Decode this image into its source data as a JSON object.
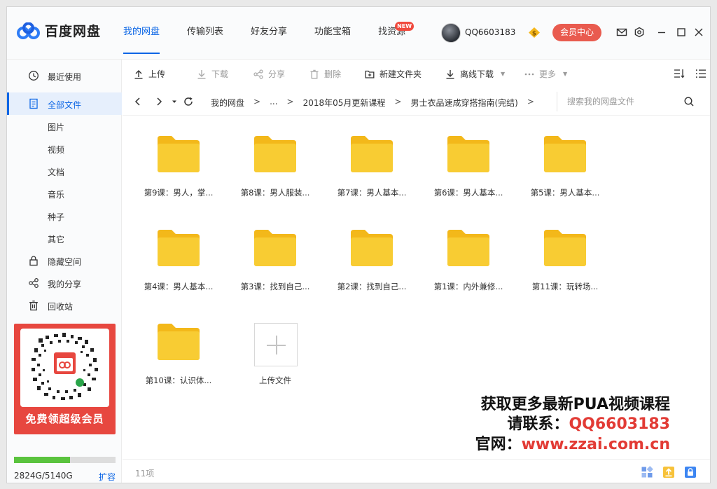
{
  "app": {
    "name": "百度网盘"
  },
  "nav": {
    "tabs": [
      {
        "label": "我的网盘",
        "active": true
      },
      {
        "label": "传输列表"
      },
      {
        "label": "好友分享"
      },
      {
        "label": "功能宝箱"
      },
      {
        "label": "找资源",
        "badge": "NEW"
      }
    ]
  },
  "user": {
    "name": "QQ6603183",
    "member_button": "会员中心",
    "coin_symbol": "$"
  },
  "sidebar": {
    "items": [
      {
        "label": "最近使用",
        "icon": "clock-icon"
      },
      {
        "label": "全部文件",
        "icon": "file-icon",
        "active": true
      },
      {
        "label": "图片"
      },
      {
        "label": "视频"
      },
      {
        "label": "文档"
      },
      {
        "label": "音乐"
      },
      {
        "label": "种子"
      },
      {
        "label": "其它"
      },
      {
        "label": "隐藏空间",
        "icon": "lock-icon"
      },
      {
        "label": "我的分享",
        "icon": "share-icon"
      },
      {
        "label": "回收站",
        "icon": "trash-icon"
      }
    ],
    "promo_text": "免费领超级会员",
    "storage": {
      "text": "2824G/5140G",
      "used_fraction": 0.55,
      "expand_label": "扩容"
    }
  },
  "toolbar": {
    "upload": "上传",
    "download": "下载",
    "share": "分享",
    "delete": "删除",
    "new_folder": "新建文件夹",
    "offline_download": "离线下载",
    "more": "更多"
  },
  "path": {
    "crumbs": [
      "我的网盘",
      "...",
      "2018年05月更新课程",
      "男士衣品速成穿搭指南(完结)"
    ],
    "separator": ">",
    "search_placeholder": "搜索我的网盘文件"
  },
  "files": [
    "第9课：男人，掌...",
    "第8课：男人服装...",
    "第7课：男人基本...",
    "第6课：男人基本...",
    "第5课：男人基本...",
    "第4课：男人基本...",
    "第3课：找到自己...",
    "第2课：找到自己...",
    "第1课：内外兼修...",
    "第11课：玩转场...",
    "第10课：认识体..."
  ],
  "upload_tile_label": "上传文件",
  "watermark": {
    "line1": "获取更多最新PUA视频课程",
    "line2_prefix": "请联系：",
    "line2_value": "QQ6603183",
    "line3_prefix": "官网：",
    "line3_value": "www.zzai.com.cn"
  },
  "status": {
    "item_count": "11项"
  },
  "colors": {
    "accent": "#0a65e5",
    "folder": "#f7c72c",
    "member": "#e95b4f",
    "promo": "#e7473f",
    "storage": "#5ac33e"
  }
}
